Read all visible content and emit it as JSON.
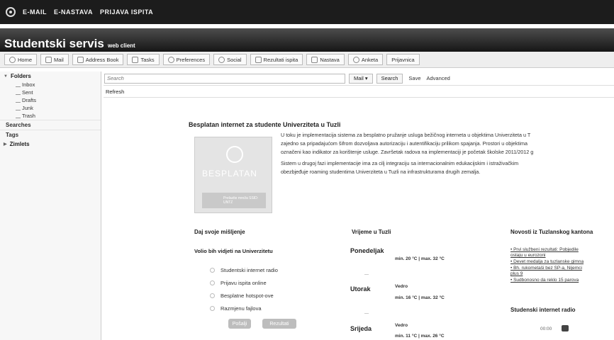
{
  "topnav": {
    "items": [
      "E-MAIL",
      "E-NASTAVA",
      "PRIJAVA ISPITA"
    ]
  },
  "header": {
    "title": "Studentski servis",
    "subtitle": "web client"
  },
  "toolbar": {
    "items": [
      "Home",
      "Mail",
      "Address Book",
      "Tasks",
      "Preferences",
      "Social",
      "Rezultati ispita",
      "Nastava",
      "Anketa",
      "Prijavnica"
    ]
  },
  "sidebar": {
    "folders_label": "Folders",
    "folders": [
      "Inbox",
      "Sent",
      "Drafts",
      "Junk",
      "Trash"
    ],
    "searches_label": "Searches",
    "tags_label": "Tags",
    "zimlets_label": "Zimlets"
  },
  "search": {
    "placeholder": "Search",
    "mail_select": "Mail",
    "search_button": "Search",
    "save_button": "Save",
    "advanced_link": "Advanced"
  },
  "refresh_label": "Refresh",
  "article": {
    "title": "Besplatan internet za studente Univerziteta u Tuzli",
    "banner_text": "BESPLATAN",
    "banner_small": "Prelazite mreža SSID: UNTZ",
    "lines": [
      "U toku je implementacija sistema za besplatno pružanje usluga bežičnog interneta u objektima Univerziteta u T",
      "zajedno sa pripadajućom šifrom dozvoljava autorizaciju i autentifikaciju prilikom spajanja. Prostori u objektima",
      "označeni kao indikator za korištenje usluge. Završetak radova na implementaciji je početak školske 2011/2012 g",
      "Sistem u drugoj fazi implementacije ima za cilj integraciju sa internacionalnim edukacijskim i istraživačkim",
      "obezbjeđuje roaming studentima Univerziteta u Tuzli na infrastrukturama drugih zemalja."
    ]
  },
  "poll": {
    "heading": "Daj svoje mišljenje",
    "question": "Volio bih vidjeti na Univerzitetu",
    "options": [
      "Studentski internet radio",
      "Prijavu ispita online",
      "Besplatne hotspot-ove",
      "Razmjenu fajlova"
    ],
    "send_button": "Pošalji",
    "results_button": "Rezultati"
  },
  "weather": {
    "heading": "Vrijeme u Tuzli",
    "days": [
      {
        "name": "Ponedeljak",
        "temp": "min. 20 °C | max. 32 °C",
        "cond": "Vedro"
      },
      {
        "name": "Utorak",
        "temp": "min. 16 °C | max. 32 °C",
        "cond": "Vedro"
      },
      {
        "name": "Srijeda",
        "temp": "min. 11 °C | max. 26 °C",
        "cond": ""
      }
    ]
  },
  "news": {
    "heading": "Novosti iz Tuzlanskog kantona",
    "lines": [
      "• Prvi službeni rezultati: Pobjedile",
      "  ostaju u eurozoni",
      "• Devet medalja za tuzlanske gimna",
      "• Bh. rukometaši bez SP-a, Nijemci",
      "  plus 9",
      "• Sudbonosno da reklo 15 parova"
    ]
  },
  "radio": {
    "heading": "Studenski internet radio",
    "time": "00:00"
  }
}
